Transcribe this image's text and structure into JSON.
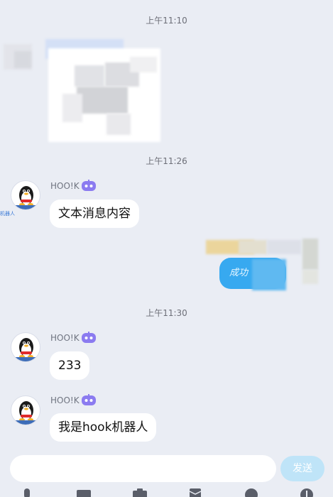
{
  "timestamps": [
    "上午11:10",
    "上午11:26",
    "上午11:30"
  ],
  "messages": [
    {
      "sender": "HOO!K",
      "text": "文本消息内容",
      "avatar_tag": "机器人"
    },
    {
      "sender": "HOO!K",
      "text": "233"
    },
    {
      "sender": "HOO!K",
      "text": "我是hook机器人"
    }
  ],
  "outgoing": {
    "text": "成功"
  },
  "input": {
    "placeholder": "",
    "send_label": "发送"
  },
  "icons": {
    "avatar": "qq-penguin-icon",
    "bot_badge": "robot-icon",
    "toolbar": [
      "voice-icon",
      "image-icon",
      "camera-icon",
      "red-packet-icon",
      "emoji-icon",
      "plus-icon"
    ]
  },
  "colors": {
    "background": "#eaedf4",
    "bubble_in": "#ffffff",
    "bubble_out": "#37a9f0",
    "send_button": "#bfe4f8",
    "bot_badge": "#8b7bf0"
  }
}
